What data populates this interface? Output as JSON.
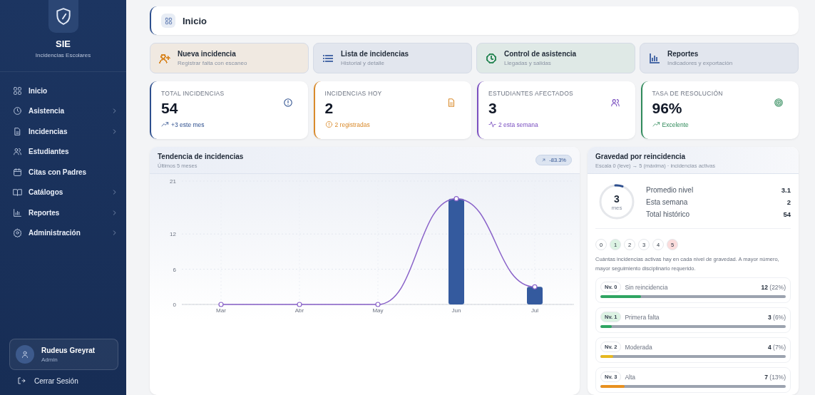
{
  "sidebar": {
    "brand": "SIE",
    "tagline": "Incidencias Escolares",
    "items": [
      {
        "label": "Inicio",
        "expandable": false
      },
      {
        "label": "Asistencia",
        "expandable": true
      },
      {
        "label": "Incidencias",
        "expandable": true
      },
      {
        "label": "Estudiantes",
        "expandable": false
      },
      {
        "label": "Citas con Padres",
        "expandable": false
      },
      {
        "label": "Catálogos",
        "expandable": true
      },
      {
        "label": "Reportes",
        "expandable": true
      },
      {
        "label": "Administración",
        "expandable": true
      }
    ],
    "user": {
      "name": "Rudeus Greyrat",
      "role": "Admin"
    },
    "logout": "Cerrar Sesión"
  },
  "header": {
    "title": "Inicio"
  },
  "quick_actions": [
    {
      "title": "Nueva incidencia",
      "subtitle": "Registrar falta con escaneo",
      "color": "#d98a2b"
    },
    {
      "title": "Lista de incidencias",
      "subtitle": "Historial y detalle",
      "color": "#4a6aa8"
    },
    {
      "title": "Control de asistencia",
      "subtitle": "Llegadas y salidas",
      "color": "#2f8a5a"
    },
    {
      "title": "Reportes",
      "subtitle": "Indicadores y exportación",
      "color": "#4a6aa8"
    }
  ],
  "stats": [
    {
      "label": "TOTAL INCIDENCIAS",
      "value": "54",
      "note": "+3 este mes",
      "color": "#2d4f8e"
    },
    {
      "label": "INCIDENCIAS HOY",
      "value": "2",
      "note": "2 registradas",
      "color": "#d98a2b"
    },
    {
      "label": "ESTUDIANTES AFECTADOS",
      "value": "3",
      "note": "2 esta semana",
      "color": "#7a4fc0"
    },
    {
      "label": "TASA DE RESOLUCIÓN",
      "value": "96%",
      "note": "Excelente",
      "color": "#2f8a5a"
    }
  ],
  "trend": {
    "title": "Tendencia de incidencias",
    "subtitle": "Últimos 5 meses",
    "badge": "-83.3%",
    "chart_data": {
      "type": "bar",
      "categories": [
        "Mar",
        "Abr",
        "May",
        "Jun",
        "Jul"
      ],
      "series": [
        {
          "color": "#345a9e",
          "values": [
            0,
            0,
            0,
            18,
            3
          ]
        },
        {
          "color": "#8a63c9",
          "values": [
            0,
            0,
            0,
            18,
            3
          ],
          "type": "line",
          "marker": true
        }
      ],
      "ylim": [
        0,
        21
      ],
      "yticks": [
        0,
        6,
        12,
        21
      ],
      "grid": true
    }
  },
  "severity": {
    "title": "Gravedad por reincidencia",
    "subtitle": "Escala 0 (leve) → 5 (máxima) · incidencias activas",
    "ring": {
      "value": "3",
      "unit": "mes",
      "level": 0.07
    },
    "summary": [
      {
        "label": "Promedio nivel",
        "value": "3.1"
      },
      {
        "label": "Esta semana",
        "value": "2"
      },
      {
        "label": "Total histórico",
        "value": "54"
      }
    ],
    "pills": [
      {
        "label": "0",
        "color": "#ffffff"
      },
      {
        "label": "1",
        "color": "#dcf3e3"
      },
      {
        "label": "2",
        "color": "#ffffff"
      },
      {
        "label": "3",
        "color": "#ffffff"
      },
      {
        "label": "4",
        "color": "#ffffff"
      },
      {
        "label": "5",
        "color": "#fbdcdc"
      }
    ],
    "description": "Cuántas incidencias activas hay en cada nivel de gravedad. A mayor número, mayor seguimiento disciplinario requerido.",
    "levels": [
      {
        "badge": {
          "label": "Nv. 0",
          "color": "#ffffff"
        },
        "name": "Sin reincidencia",
        "count": "12",
        "percent": "(22%)",
        "level": 0.22,
        "color": "#2fa562"
      },
      {
        "badge": {
          "label": "Nv. 1",
          "color": "#dcf3e3"
        },
        "name": "Primera falta",
        "count": "3",
        "percent": "(6%)",
        "level": 0.06,
        "color": "#2fa562"
      },
      {
        "badge": {
          "label": "Nv. 2",
          "color": "#ffffff"
        },
        "name": "Moderada",
        "count": "4",
        "percent": "(7%)",
        "level": 0.07,
        "color": "#e6b820"
      },
      {
        "badge": {
          "label": "Nv. 3",
          "color": "#ffffff"
        },
        "name": "Alta",
        "count": "7",
        "percent": "(13%)",
        "level": 0.13,
        "color": "#e8901f"
      }
    ]
  }
}
